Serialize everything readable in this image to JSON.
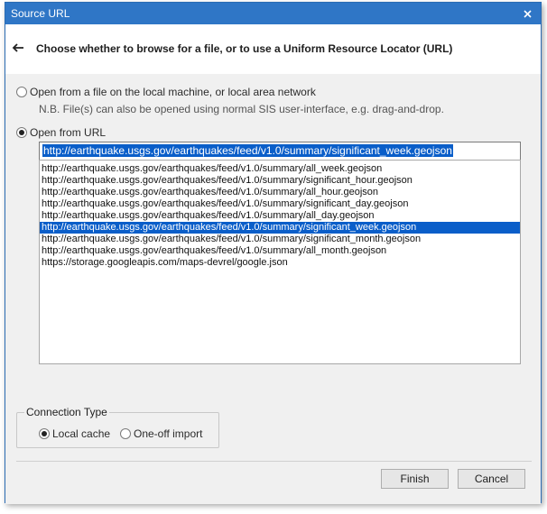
{
  "window": {
    "title": "Source URL"
  },
  "header": {
    "heading": "Choose whether to browse for a file, or to use a Uniform Resource Locator (URL)"
  },
  "options": {
    "file_label": "Open from a file on the local machine, or local area network",
    "file_note": "N.B. File(s) can also be opened using normal SIS user-interface, e.g. drag-and-drop.",
    "url_label": "Open from URL",
    "url_value": "http://earthquake.usgs.gov/earthquakes/feed/v1.0/summary/significant_week.geojson"
  },
  "url_list": {
    "items": [
      "http://earthquake.usgs.gov/earthquakes/feed/v1.0/summary/all_week.geojson",
      "http://earthquake.usgs.gov/earthquakes/feed/v1.0/summary/significant_hour.geojson",
      "http://earthquake.usgs.gov/earthquakes/feed/v1.0/summary/all_hour.geojson",
      "http://earthquake.usgs.gov/earthquakes/feed/v1.0/summary/significant_day.geojson",
      "http://earthquake.usgs.gov/earthquakes/feed/v1.0/summary/all_day.geojson",
      "http://earthquake.usgs.gov/earthquakes/feed/v1.0/summary/significant_week.geojson",
      "http://earthquake.usgs.gov/earthquakes/feed/v1.0/summary/significant_month.geojson",
      "http://earthquake.usgs.gov/earthquakes/feed/v1.0/summary/all_month.geojson",
      "https://storage.googleapis.com/maps-devrel/google.json"
    ],
    "selected_index": 5
  },
  "connection": {
    "title": "Connection Type",
    "local_cache_label": "Local cache",
    "one_off_label": "One-off import",
    "selected": "Local cache"
  },
  "buttons": {
    "finish": "Finish",
    "cancel": "Cancel"
  },
  "colors": {
    "titlebar": "#2f76c6",
    "selection": "#0a5ec9",
    "dialog_body": "#f0f0f0"
  }
}
